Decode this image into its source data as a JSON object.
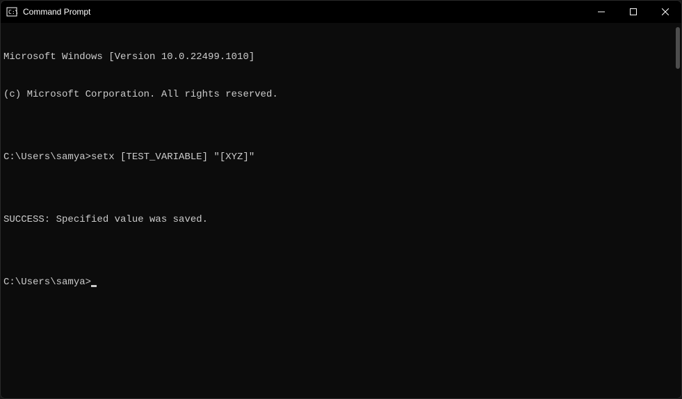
{
  "titlebar": {
    "title": "Command Prompt"
  },
  "terminal": {
    "lines": [
      "Microsoft Windows [Version 10.0.22499.1010]",
      "(c) Microsoft Corporation. All rights reserved.",
      "",
      "C:\\Users\\samya>setx [TEST_VARIABLE] \"[XYZ]\"",
      "",
      "SUCCESS: Specified value was saved.",
      ""
    ],
    "current_prompt": "C:\\Users\\samya>"
  }
}
